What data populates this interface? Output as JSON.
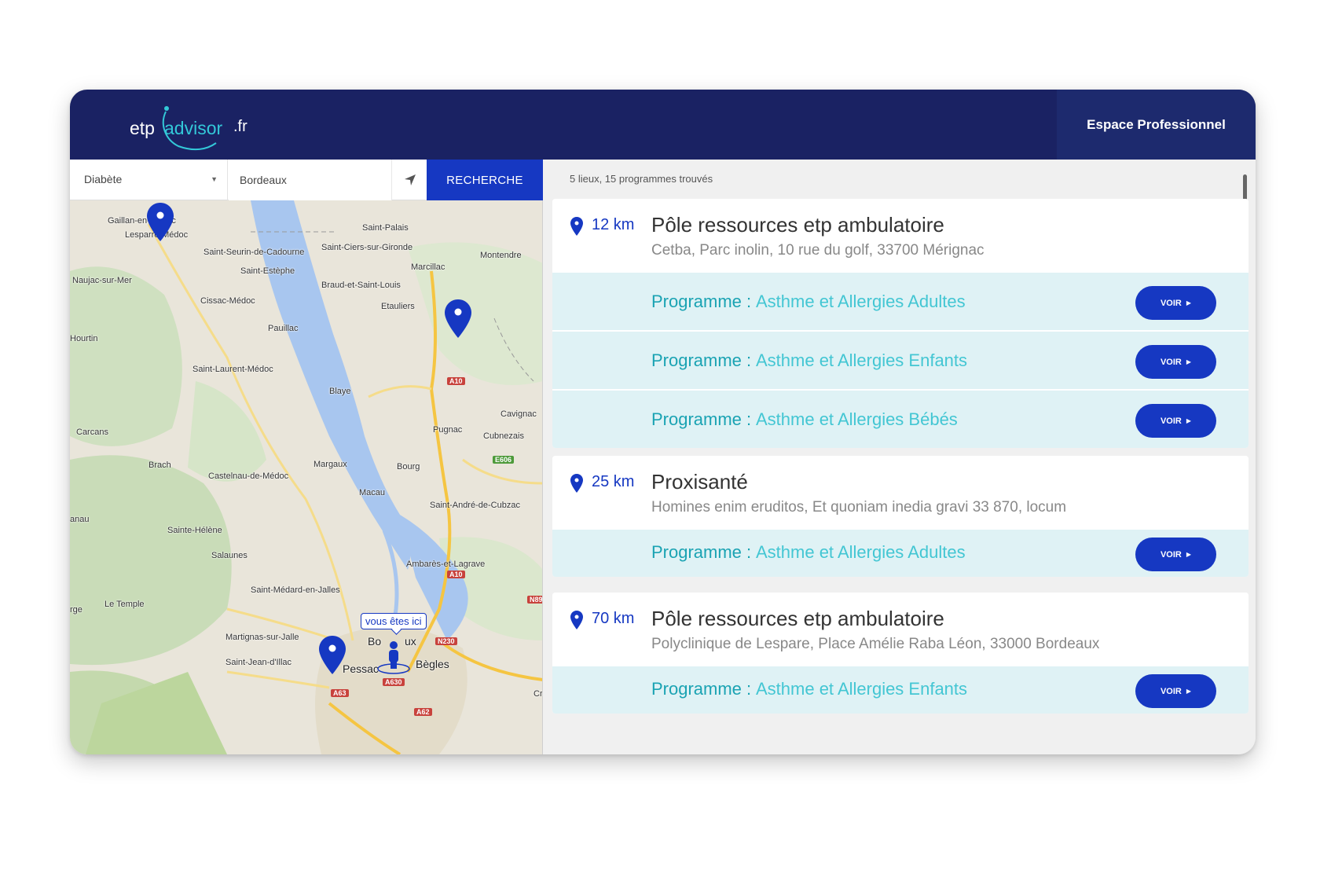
{
  "header": {
    "logo": {
      "part1": "etp",
      "part2": "advisor",
      "part3": ".fr"
    },
    "pro_button": "Espace Professionnel"
  },
  "search": {
    "category_value": "Diabète",
    "city_value": "Bordeaux",
    "submit_label": "RECHERCHE"
  },
  "map": {
    "places": [
      "Gaillan-en-Médoc",
      "Lesparre-Médoc",
      "Saint-Palais",
      "Saint-Seurin-de-Cadourne",
      "Saint-Ciers-sur-Gironde",
      "Montendre",
      "Saint-Estèphe",
      "Marcillac",
      "Naujac-sur-Mer",
      "Braud-et-Saint-Louis",
      "Cissac-Médoc",
      "Etauliers",
      "Pauillac",
      "Hourtin",
      "Saint-Laurent-Médoc",
      "Blaye",
      "Cavignac",
      "Carcans",
      "Pugnac",
      "Cubnezais",
      "Brach",
      "Castelnau-de-Médoc",
      "Margaux",
      "Bourg",
      "Macau",
      "Saint-André-de-Cubzac",
      "anau",
      "Sainte-Hélène",
      "Salaunes",
      "Ambarès-et-Lagrave",
      "Saint-Médard-en-Jalles",
      "Le Temple",
      "rge",
      "Martignas-sur-Jalle",
      "Bo",
      "ux",
      "Saint-Jean-d'Illac",
      "Pessac",
      "Bègles",
      "Cr"
    ],
    "roads": [
      "A10",
      "E606",
      "A10",
      "N89",
      "N230",
      "A63",
      "A630",
      "A62"
    ],
    "here_label": "vous êtes ici"
  },
  "results": {
    "count_text": "5 lieux, 15  programmes trouvés",
    "program_label": "Programme :",
    "button_label": "VOIR",
    "places": [
      {
        "distance": "12 km",
        "name": "Pôle ressources etp ambulatoire",
        "address": "Cetba, Parc inolin, 10 rue du golf, 33700 Mérignac",
        "programs": [
          "Asthme et Allergies Adultes",
          "Asthme et Allergies Enfants",
          "Asthme et Allergies Bébés"
        ]
      },
      {
        "distance": "25 km",
        "name": "Proxisanté",
        "address": "Homines enim eruditos, Et quoniam inedia gravi 33 870, locum",
        "programs": [
          "Asthme et Allergies Adultes"
        ]
      },
      {
        "distance": "70 km",
        "name": "Pôle ressources etp ambulatoire",
        "address": "Polyclinique de Lespare, Place Amélie Raba Léon, 33000 Bordeaux",
        "programs": [
          "Asthme et Allergies Enfants"
        ]
      }
    ]
  },
  "colors": {
    "header_bg": "#1a2263",
    "accent_blue": "#1638c2",
    "teal": "#43c6d3",
    "program_row_bg": "#dff2f5"
  }
}
